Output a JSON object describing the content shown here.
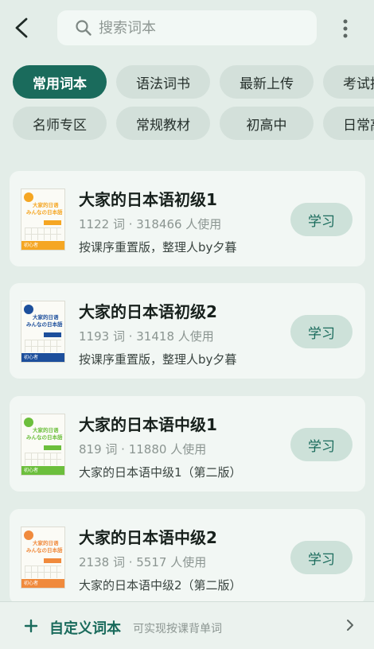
{
  "header": {
    "search_placeholder": "搜索词本"
  },
  "chips": {
    "row1": [
      "常用词本",
      "语法词书",
      "最新上传",
      "考试推荐"
    ],
    "row2": [
      "名师专区",
      "常规教材",
      "初高中",
      "日常高频"
    ],
    "active": "常用词本"
  },
  "books": [
    {
      "title": "大家的日本语初级1",
      "words": "1122 词",
      "users": "318466 人使用",
      "desc": "按课序重置版，整理人by夕暮",
      "cover_title_1": "大家的日语",
      "cover_title_2": "みんなの日本語",
      "cover_band_text": "初心者",
      "cover_color": "#f5a623",
      "action": "学习"
    },
    {
      "title": "大家的日本语初级2",
      "words": "1193 词",
      "users": "31418 人使用",
      "desc": "按课序重置版，整理人by夕暮",
      "cover_title_1": "大家的日语",
      "cover_title_2": "みんなの日本語",
      "cover_band_text": "初心者",
      "cover_color": "#1d4f9c",
      "action": "学习"
    },
    {
      "title": "大家的日本语中级1",
      "words": "819 词",
      "users": "11880 人使用",
      "desc": "大家的日本语中级1（第二版）",
      "cover_title_1": "大家的日语",
      "cover_title_2": "みんなの日本語",
      "cover_band_text": "初心者",
      "cover_color": "#6cbf3c",
      "action": "学习"
    },
    {
      "title": "大家的日本语中级2",
      "words": "2138 词",
      "users": "5517 人使用",
      "desc": "大家的日本语中级2（第二版）",
      "cover_title_1": "大家的日语",
      "cover_title_2": "みんなの日本語",
      "cover_band_text": "初心者",
      "cover_color": "#f08a3c",
      "action": "学习"
    }
  ],
  "footer": {
    "custom_label": "自定义词本",
    "custom_hint": "可实现按课背单词"
  },
  "colors": {
    "accent": "#1a6b5c",
    "background": "#e3ede8",
    "card": "#f2f7f4"
  }
}
